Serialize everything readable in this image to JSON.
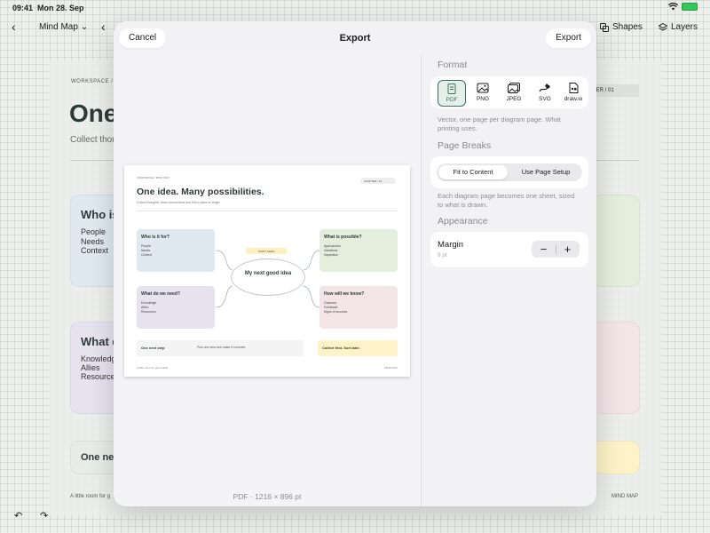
{
  "status": {
    "time": "09:41",
    "date": "Mon 28. Sep"
  },
  "toolbar": {
    "doc_title": "Mind Map",
    "shapes": "Shapes",
    "layers": "Layers"
  },
  "background": {
    "breadcrumb": "WORKSPACE /",
    "title": "One",
    "subtitle": "Collect thou",
    "chapter": "TER / 01",
    "cards": [
      {
        "heading": "Who is",
        "lines": [
          "People",
          "Needs",
          "Context"
        ]
      },
      {
        "heading": "What d",
        "lines": [
          "Knowledg",
          "Allies",
          "Resource"
        ]
      }
    ],
    "bottom_card": "One nex",
    "footer_left": "A little room for g",
    "footer_right": "MIND MAP"
  },
  "modal": {
    "title": "Export",
    "cancel_label": "Cancel",
    "export_label": "Export",
    "preview": {
      "breadcrumb": "WORKSPACE / MIND MAP",
      "chapter": "CHAPTER / 01",
      "title": "One idea. Many possibilities.",
      "subtitle": "Collect thoughts, draw connections and find a place to begin.",
      "center": "My next good idea",
      "tag": "START HERE",
      "cards": [
        {
          "heading": "Who is it for?",
          "lines": [
            "People",
            "Needs",
            "Context"
          ]
        },
        {
          "heading": "What is possible?",
          "lines": [
            "Approaches",
            "Variations",
            "Inspiration"
          ]
        },
        {
          "heading": "What do we need?",
          "lines": [
            "Knowledge",
            "Allies",
            "Resources"
          ]
        },
        {
          "heading": "How will we know?",
          "lines": [
            "Outcome",
            "Feedback",
            "Signs of success"
          ]
        }
      ],
      "next_step_heading": "One next step",
      "next_step_text": "Pick one idea and make it concrete.",
      "collect": "Collect first. Sort later.",
      "footer_left": "A little room for good ideas",
      "footer_right": "MIND MAP",
      "caption": "PDF · 1216 × 896 pt"
    },
    "format": {
      "label": "Format",
      "selected": "PDF",
      "options": [
        {
          "label": "PDF",
          "icon": "pdf-file-icon"
        },
        {
          "label": "PNG",
          "icon": "image-icon"
        },
        {
          "label": "JPEG",
          "icon": "photos-icon"
        },
        {
          "label": "SVG",
          "icon": "pen-curve-icon"
        },
        {
          "label": "draw.io",
          "icon": "document-shapes-icon"
        }
      ],
      "help": "Vector, one page per diagram page. What printing uses."
    },
    "page_breaks": {
      "label": "Page Breaks",
      "options": [
        "Fit to Content",
        "Use Page Setup"
      ],
      "selected": "Fit to Content",
      "help": "Each diagram page becomes one sheet, sized to what is drawn."
    },
    "appearance": {
      "label": "Appearance",
      "margin_label": "Margin",
      "margin_value": "8 pt",
      "minus": "−",
      "plus": "+"
    }
  },
  "colors": {
    "accent": "#3f6f5d",
    "card_blue": "#dfe9ef",
    "card_green": "#e4eedc",
    "card_lavender": "#e6e3ef",
    "card_pink": "#f3e4e8",
    "note_yellow": "#fdf2c8"
  }
}
